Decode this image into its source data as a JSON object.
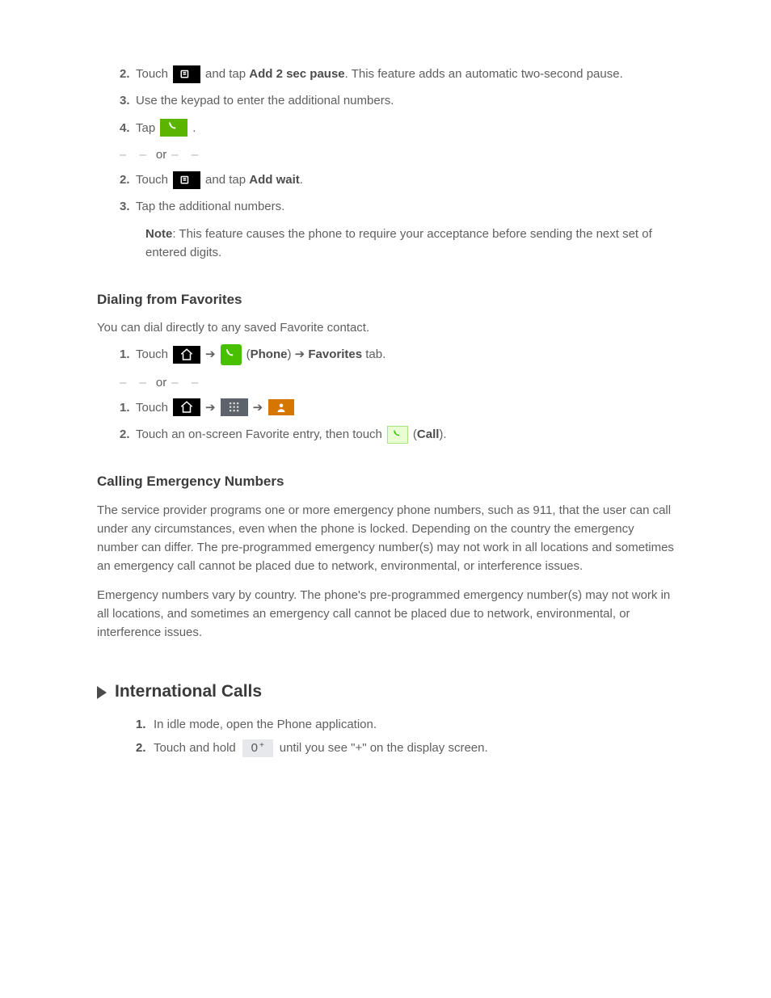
{
  "top": {
    "step2_num": "2.",
    "step2a": "Touch",
    "step2b": "and tap ",
    "step2c": "Add 2 sec pause",
    "step2d": ". This feature adds an automatic two-second pause.",
    "step3_num": "3.",
    "step3a": "Use the keypad to enter the additional numbers.",
    "step4_num": "4.",
    "step4a": "Tap",
    "step4b": "."
  },
  "or": {
    "dashes": "–  –",
    "label": "or"
  },
  "wait": {
    "step2_num": "2.",
    "step2a": "Touch",
    "step2b": "and tap ",
    "step2c": "Add wait",
    "step2d": ".",
    "step3_num": "3.",
    "step3a": "Tap the additional numbers.",
    "note": "Note",
    "note_body": ": This feature causes the phone to require your acceptance before sending the next set of entered digits."
  },
  "heading_favorites": "Dialing from Favorites",
  "fav": {
    "intro": "You can dial directly to any saved Favorite contact.",
    "step1_num": "1.",
    "step1a": "Touch",
    "step1b": "➔",
    "step1c": "(",
    "step1d": "Phone",
    "step1e": ") ➔ ",
    "step1f": "Favorites",
    "step1g": " tab.",
    "or_dashes": "–  –",
    "or": "or",
    "alt_step_num": "1.",
    "alt_a": "Touch",
    "alt_b": "➔",
    "alt_c": "➔",
    "step2_num": "2.",
    "step2a": "Touch an on-screen Favorite entry, then touch",
    "step2b": "(",
    "step2c": "Call",
    "step2d": ")."
  },
  "emergency": {
    "heading": "Calling Emergency Numbers",
    "p1": "The service provider programs one or more emergency phone numbers, such as 911, that the user can call under any circumstances, even when the phone is locked. Depending on the country the emergency number can differ. The pre-programmed emergency number(s) may not work in all locations and sometimes an emergency call cannot be placed due to network, environmental, or interference issues.",
    "p2a": "Emergency numbers vary by country. The phone's pre-programmed emergency number(s) may not work in all locations, and sometimes an emergency call cannot be placed due to network, environmental, or interference issues."
  },
  "intl": {
    "title": "International Calls",
    "step1_num": "1.",
    "step1": "In idle mode, open the Phone application.",
    "step2_num": "2.",
    "step2a": "Touch and hold",
    "step2b": "until you see \"+\" on the display screen."
  }
}
